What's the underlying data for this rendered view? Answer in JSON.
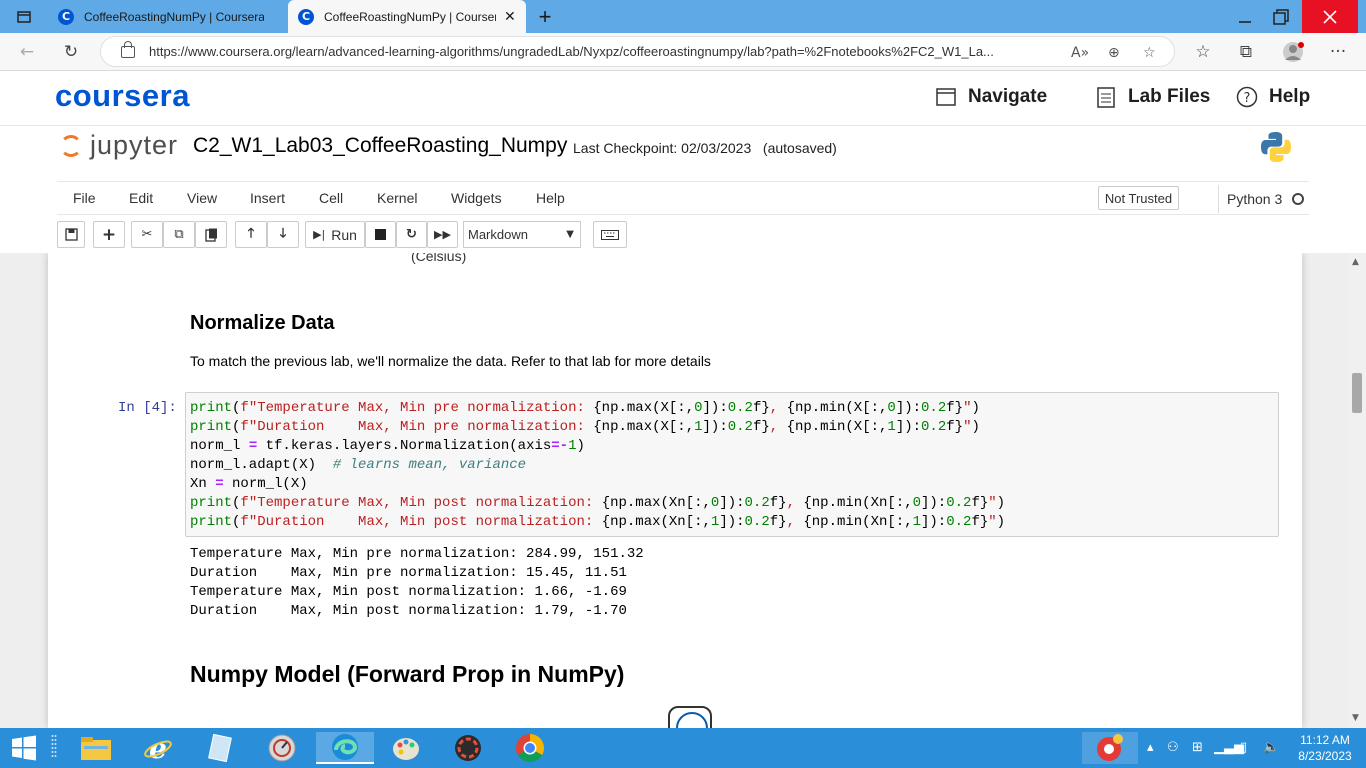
{
  "browser": {
    "tabs": [
      {
        "title": "CoffeeRoastingNumPy | Coursera",
        "active": false
      },
      {
        "title": "CoffeeRoastingNumPy | Coursera",
        "active": true
      }
    ],
    "new_tab": "+",
    "url": "https://www.coursera.org/learn/advanced-learning-algorithms/ungradedLab/Nyxpz/coffeeroastingnumpy/lab?path=%2Fnotebooks%2FC2_W1_La...",
    "window_controls": [
      "minimize",
      "maximize",
      "close"
    ],
    "tab_favicon": "C",
    "tab_close": "✕"
  },
  "coursera": {
    "logo": "coursera",
    "nav": [
      {
        "label": "Navigate",
        "icon": "navigate-icon"
      },
      {
        "label": "Lab Files",
        "icon": "lab-files-icon"
      },
      {
        "label": "Help",
        "icon": "help-icon"
      }
    ]
  },
  "jupyter": {
    "logo": "jupyter",
    "notebook_name": "C2_W1_Lab03_CoffeeRoasting_Numpy",
    "checkpoint": "Last Checkpoint: 02/03/2023   (autosaved)",
    "menu": [
      "File",
      "Edit",
      "View",
      "Insert",
      "Cell",
      "Kernel",
      "Widgets",
      "Help"
    ],
    "trust": "Not Trusted",
    "kernel": "Python 3",
    "toolbar": {
      "run_label": "Run",
      "cell_type": "Markdown"
    }
  },
  "notebook": {
    "partial_text": "(Celsius)",
    "section_title": "Normalize Data",
    "paragraph": "To match the previous lab, we'll normalize the data. Refer to that lab for more details",
    "prompt": "In [4]:",
    "output_lines": [
      "Temperature Max, Min pre normalization: 284.99, 151.32",
      "Duration    Max, Min pre normalization: 15.45, 11.51",
      "Temperature Max, Min post normalization: 1.66, -1.69",
      "Duration    Max, Min post normalization: 1.79, -1.70"
    ],
    "next_section_title": "Numpy Model (Forward Prop in NumPy)"
  },
  "taskbar": {
    "time": "11:12 AM",
    "date": "8/23/2023"
  },
  "colors": {
    "coursera_blue": "#0056d2",
    "jupyter_orange": "#f37726",
    "taskbar": "#2a8fd8",
    "tabbar": "#5ea9e6"
  }
}
